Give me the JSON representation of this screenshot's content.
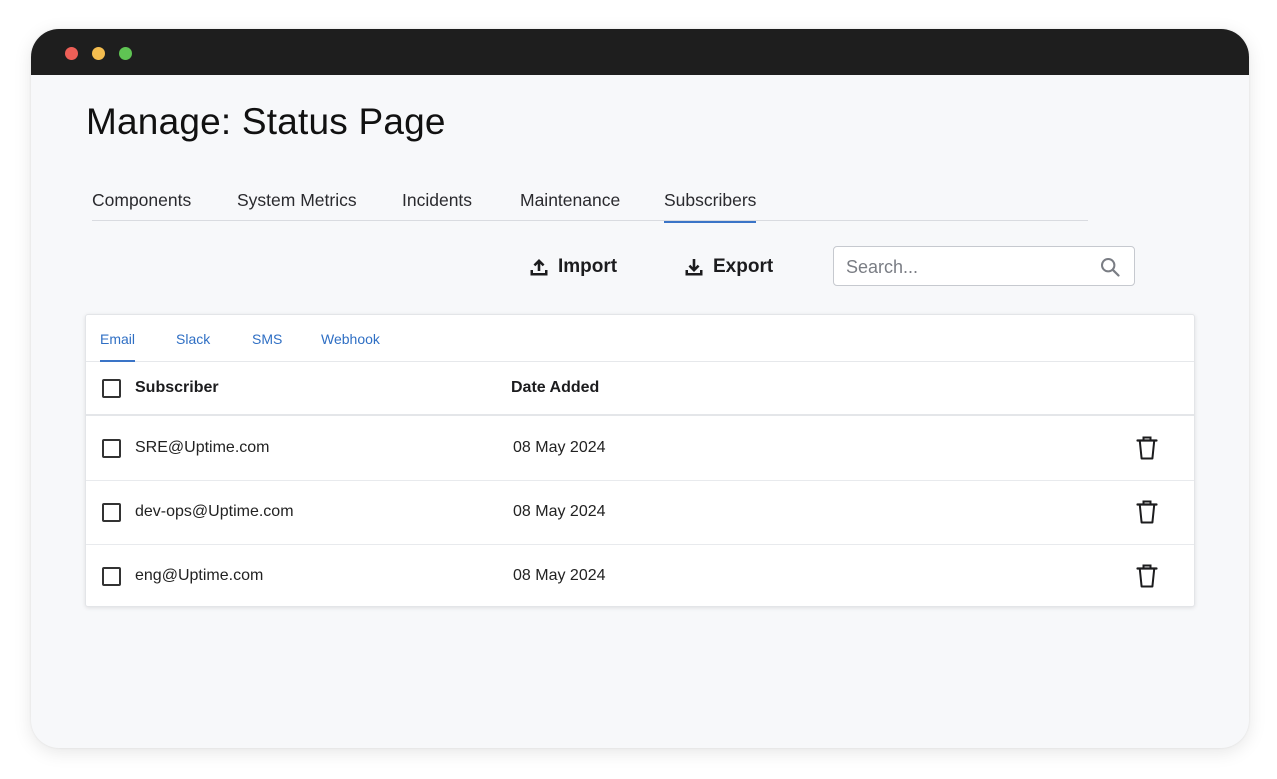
{
  "window": {
    "controls": [
      "close",
      "minimize",
      "maximize"
    ]
  },
  "page": {
    "title": "Manage: Status Page"
  },
  "tabs": [
    {
      "label": "Components",
      "active": false
    },
    {
      "label": "System Metrics",
      "active": false
    },
    {
      "label": "Incidents",
      "active": false
    },
    {
      "label": "Maintenance",
      "active": false
    },
    {
      "label": "Subscribers",
      "active": true
    }
  ],
  "toolbar": {
    "import_label": "Import",
    "import_icon": "upload-icon",
    "export_label": "Export",
    "export_icon": "download-icon"
  },
  "search": {
    "placeholder": "Search...",
    "value": "",
    "icon": "search-icon"
  },
  "subtabs": [
    {
      "label": "Email",
      "active": true
    },
    {
      "label": "Slack",
      "active": false
    },
    {
      "label": "SMS",
      "active": false
    },
    {
      "label": "Webhook",
      "active": false
    }
  ],
  "table": {
    "columns": [
      "Subscriber",
      "Date Added"
    ],
    "rows": [
      {
        "subscriber": "SRE@Uptime.com",
        "date_added": "08 May 2024",
        "checked": false
      },
      {
        "subscriber": "dev-ops@Uptime.com",
        "date_added": "08 May 2024",
        "checked": false
      },
      {
        "subscriber": "eng@Uptime.com",
        "date_added": "08 May 2024",
        "checked": false
      }
    ],
    "row_action_icon": "trash-icon"
  },
  "colors": {
    "accent": "#3a74c7",
    "titlebar": "#1e1e1e",
    "background": "#f7f8fa"
  }
}
